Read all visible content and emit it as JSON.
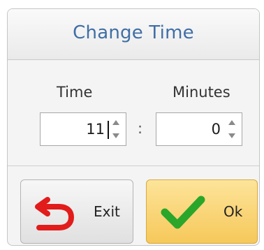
{
  "dialog": {
    "title": "Change Time",
    "time_label": "Time",
    "minutes_label": "Minutes",
    "time_value": "11",
    "minutes_value": "0",
    "separator": ":",
    "exit_label": "Exit",
    "ok_label": "Ok"
  },
  "icons": {
    "exit": "undo-arrow-icon",
    "ok": "checkmark-icon",
    "spin_up": "spin-up-icon",
    "spin_down": "spin-down-icon"
  },
  "colors": {
    "title": "#3f6ea6",
    "exit_icon": "#e21b1b",
    "ok_icon": "#2aa62a",
    "ok_button": "#f6c85a"
  }
}
